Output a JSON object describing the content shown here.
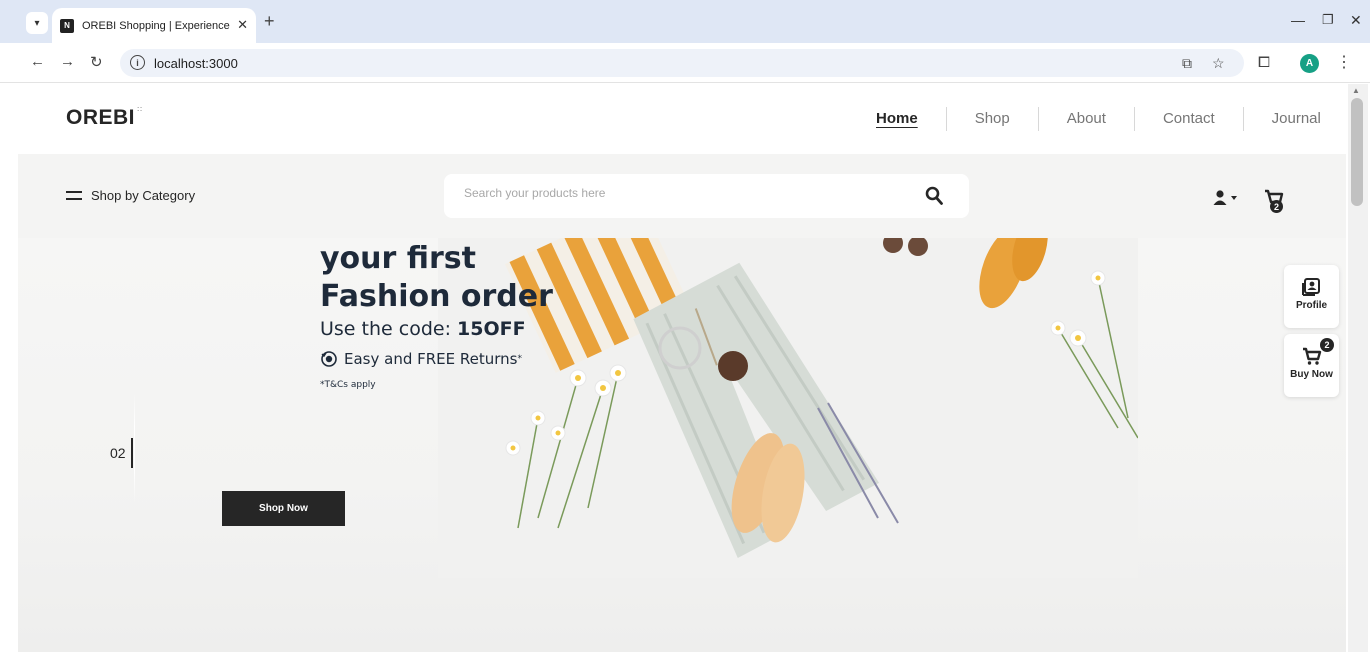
{
  "browser": {
    "tab_title": "OREBI Shopping | Experience th",
    "url": "localhost:3000",
    "avatar_letter": "A"
  },
  "header": {
    "logo": "OREBI",
    "logo_mark": "::",
    "nav": [
      "Home",
      "Shop",
      "About",
      "Contact",
      "Journal"
    ],
    "active_nav": "Home"
  },
  "subbar": {
    "category_label": "Shop by Category",
    "search_placeholder": "Search your products here",
    "cart_count": "2"
  },
  "banner": {
    "headline_line1": "your first",
    "headline_line2": "Fashion order",
    "code_prefix": "Use the code: ",
    "code": "15OFF",
    "returns": "Easy and FREE Returns",
    "returns_mark": "*",
    "tcs": "*T&Cs apply",
    "slide_number": "02",
    "cta": "Shop Now"
  },
  "side_widgets": {
    "profile_label": "Profile",
    "buy_label": "Buy Now",
    "buy_count": "2"
  },
  "colors": {
    "dark": "#262626",
    "banner_bg": "#f4f4f3",
    "headline": "#1e2a3a",
    "accent_orange": "#e9a23b"
  }
}
